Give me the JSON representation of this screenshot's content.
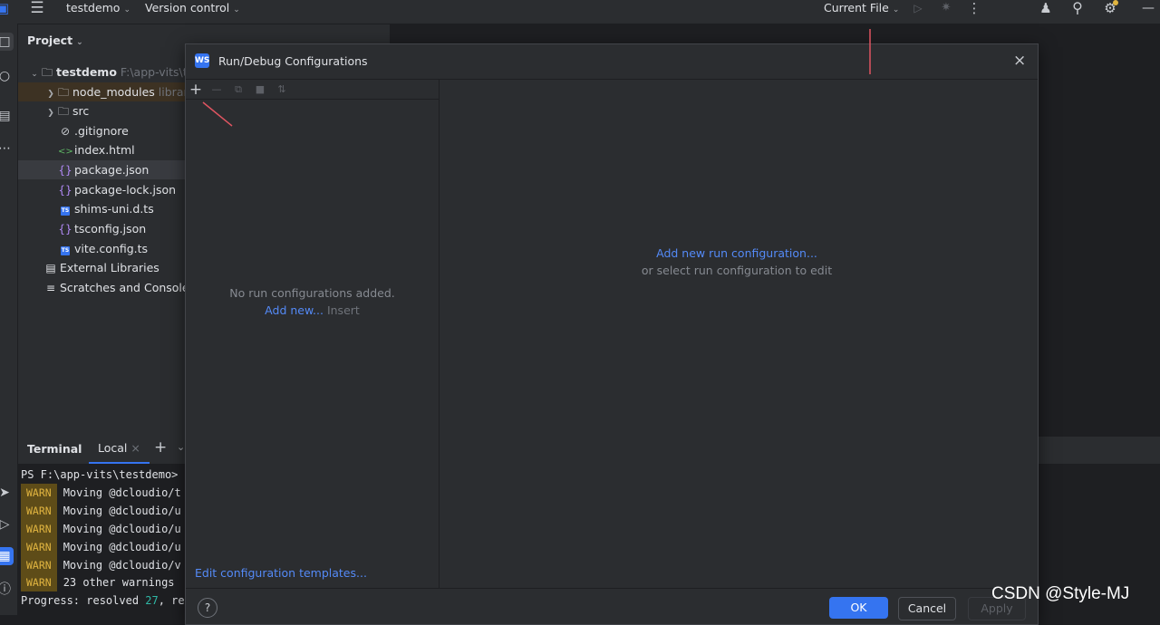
{
  "topbar": {
    "project_name": "testdemo",
    "vcs_label": "Version control",
    "run_config": "Current File"
  },
  "project_panel": {
    "title": "Project",
    "root": {
      "name": "testdemo",
      "path": "F:\\app-vits\\te"
    },
    "items": [
      {
        "label": "node_modules",
        "extra": "library",
        "kind": "folder"
      },
      {
        "label": "src",
        "kind": "folder"
      },
      {
        "label": ".gitignore",
        "kind": "ignore"
      },
      {
        "label": "index.html",
        "kind": "html"
      },
      {
        "label": "package.json",
        "kind": "json"
      },
      {
        "label": "package-lock.json",
        "kind": "json"
      },
      {
        "label": "shims-uni.d.ts",
        "kind": "ts"
      },
      {
        "label": "tsconfig.json",
        "kind": "json"
      },
      {
        "label": "vite.config.ts",
        "kind": "ts"
      },
      {
        "label": "External Libraries",
        "kind": "library"
      },
      {
        "label": "Scratches and Consoles",
        "kind": "scratches"
      }
    ]
  },
  "terminal": {
    "title": "Terminal",
    "tab": "Local",
    "prompt": "PS F:\\app-vits\\testdemo>",
    "warn_badge": "WARN",
    "lines": [
      "Moving @dcloudio/t",
      "Moving @dcloudio/u",
      "Moving @dcloudio/u",
      "Moving @dcloudio/u",
      "Moving @dcloudio/v",
      "23 other warnings"
    ],
    "progress_prefix": "Progress: resolved ",
    "progress_num": "27",
    "progress_suffix": ", re"
  },
  "dialog": {
    "title": "Run/Debug Configurations",
    "empty_text": "No run configurations added.",
    "add_new_link": "Add new...",
    "insert_hint": "Insert",
    "edit_templates_link": "Edit configuration templates...",
    "add_config_link": "Add new run configuration...",
    "select_hint": "or select run configuration to edit",
    "ok": "OK",
    "cancel": "Cancel",
    "apply": "Apply",
    "help": "?"
  },
  "watermark": "CSDN @Style-MJ",
  "colors": {
    "accent": "#3574f0",
    "link": "#548af7",
    "annotation_arrow": "#e05561"
  }
}
